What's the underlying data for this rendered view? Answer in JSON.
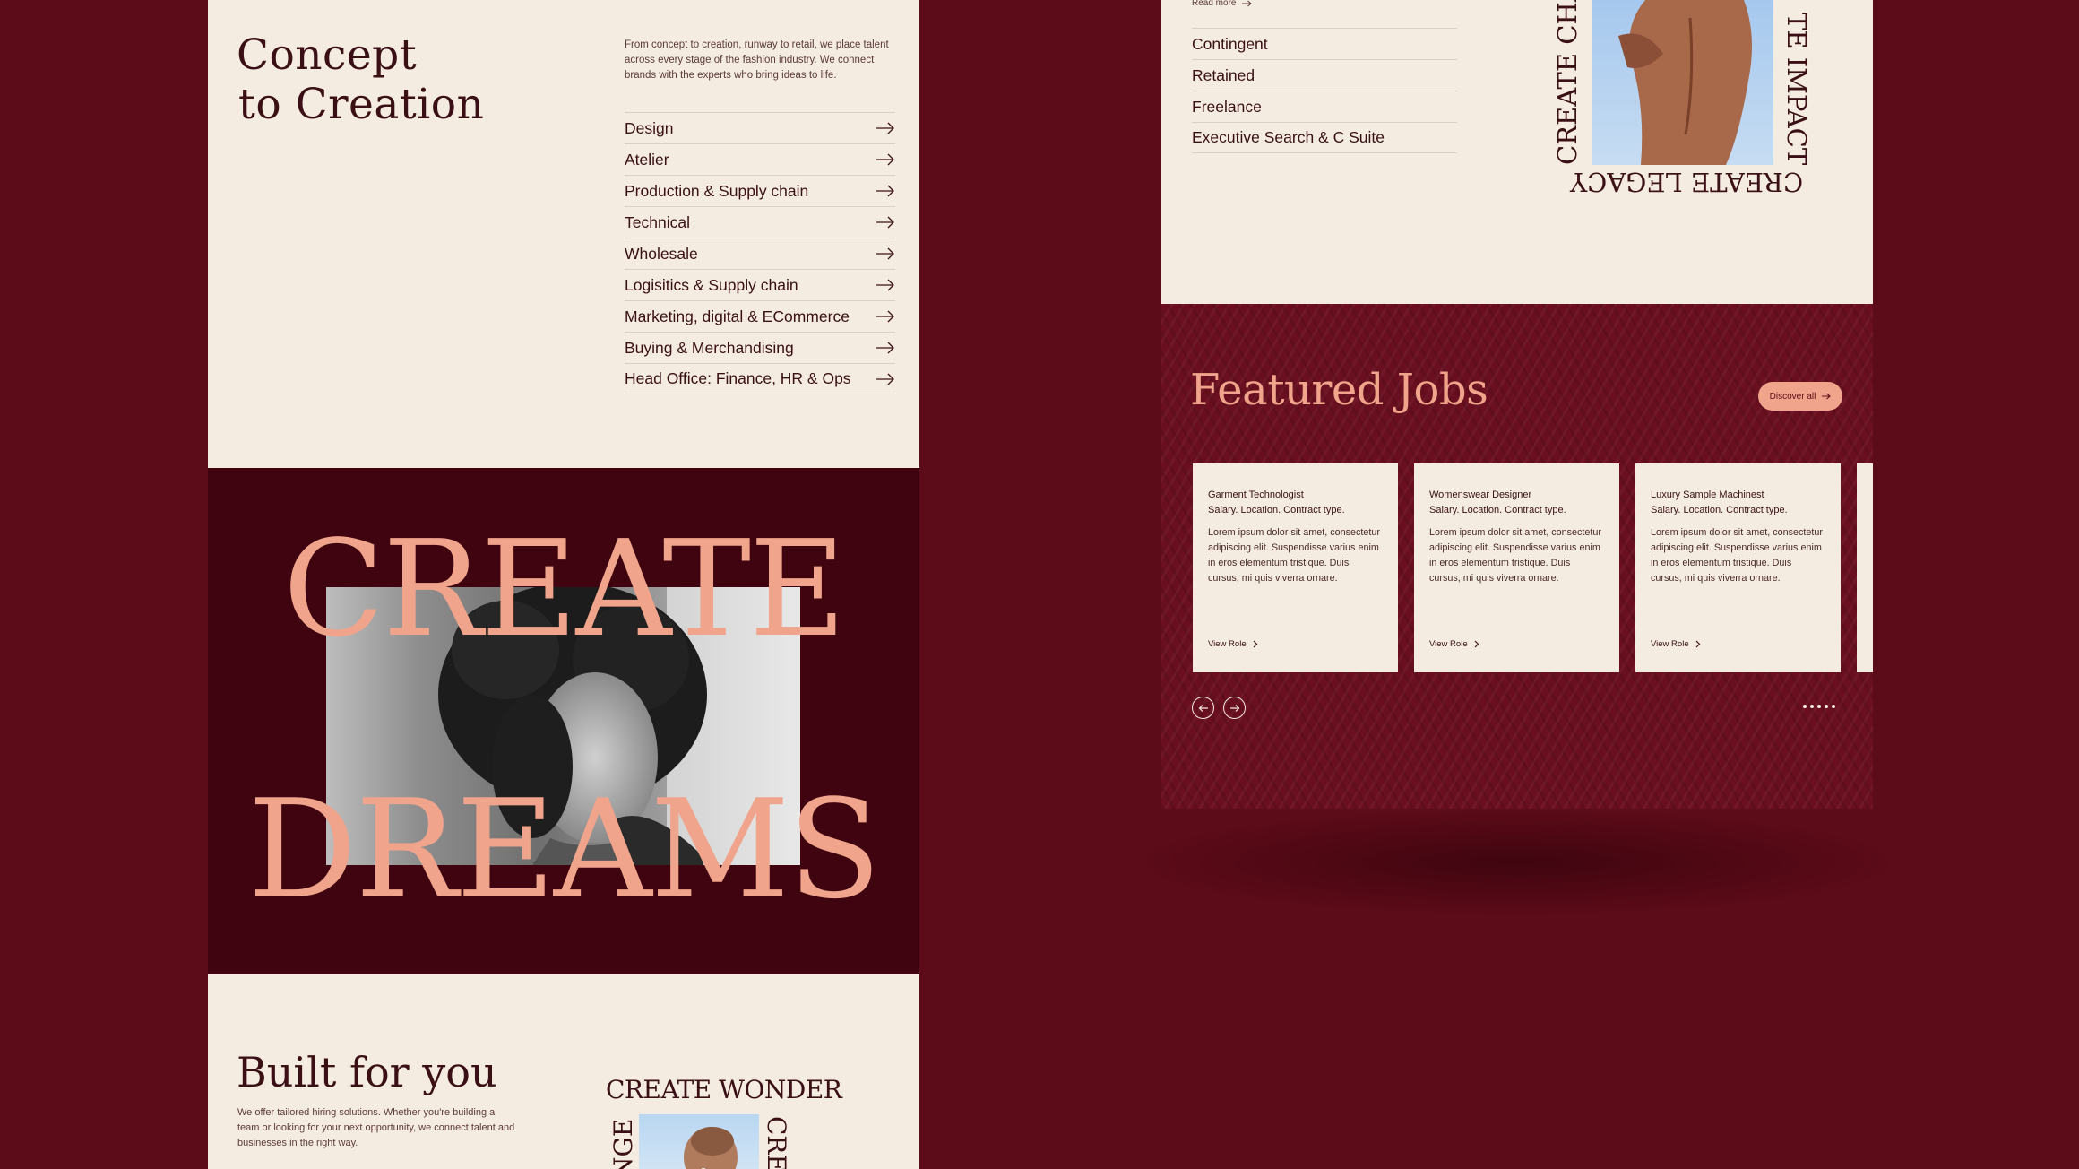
{
  "concept": {
    "title_line1": "Concept",
    "title_line2": "to Creation",
    "intro": "From concept to creation, runway to retail, we place talent across every stage of the fashion industry. We connect brands with the experts who  bring ideas to life.",
    "sectors": [
      {
        "label": "Design"
      },
      {
        "label": "Atelier"
      },
      {
        "label": "Production & Supply chain"
      },
      {
        "label": "Technical"
      },
      {
        "label": "Wholesale"
      },
      {
        "label": "Logisitics & Supply chain"
      },
      {
        "label": "Marketing, digital & ECommerce"
      },
      {
        "label": "Buying & Merchandising"
      },
      {
        "label": "Head Office: Finance, HR & Ops"
      }
    ]
  },
  "hero": {
    "word1": "CREATE",
    "word2": "DREAMS"
  },
  "built": {
    "title": "Built for you",
    "text": "We offer tailored hiring solutions. Whether you're building a team or looking for your next opportunity, we connect talent and businesses in the right way.",
    "wonder_heading": "CREATE WONDER",
    "vert_left": "NGE",
    "vert_right": "CRE"
  },
  "hiring_types": {
    "read_more": "Read more",
    "items": [
      {
        "label": "Contingent"
      },
      {
        "label": "Retained"
      },
      {
        "label": "Freelance"
      },
      {
        "label": "Executive Search & C Suite"
      }
    ],
    "vert_left": "CREATE CHA",
    "vert_right": "TE IMPACT",
    "legacy": "CREATE LEGACY"
  },
  "jobs": {
    "title": "Featured Jobs",
    "discover_label": "Discover all",
    "cards": [
      {
        "title": "Garment Technologist",
        "meta": "Salary. Location. Contract type.",
        "desc": "Lorem ipsum dolor sit amet, consectetur adipiscing elit. Suspendisse varius enim in eros elementum tristique. Duis cursus, mi quis viverra ornare.",
        "link": "View Role"
      },
      {
        "title": "Womenswear Designer",
        "meta": "Salary. Location. Contract type.",
        "desc": "Lorem ipsum dolor sit amet, consectetur adipiscing elit. Suspendisse varius enim in eros elementum tristique. Duis cursus, mi quis viverra ornare.",
        "link": "View Role"
      },
      {
        "title": "Luxury Sample Machinest",
        "meta": " Salary. Location. Contract type.",
        "desc": "Lorem ipsum dolor sit amet, consectetur adipiscing elit. Suspendisse varius enim in eros elementum tristique. Duis cursus, mi quis viverra ornare.",
        "link": "View Role"
      }
    ],
    "nav": {
      "prev": "arrow-left-icon",
      "next": "arrow-right-icon"
    },
    "dots_count": 5
  },
  "colors": {
    "background": "#5c0b18",
    "cream": "#f4ece1",
    "accent": "#f0a48b",
    "dark_text": "#3a1015",
    "hero_bg": "#3f0410"
  }
}
